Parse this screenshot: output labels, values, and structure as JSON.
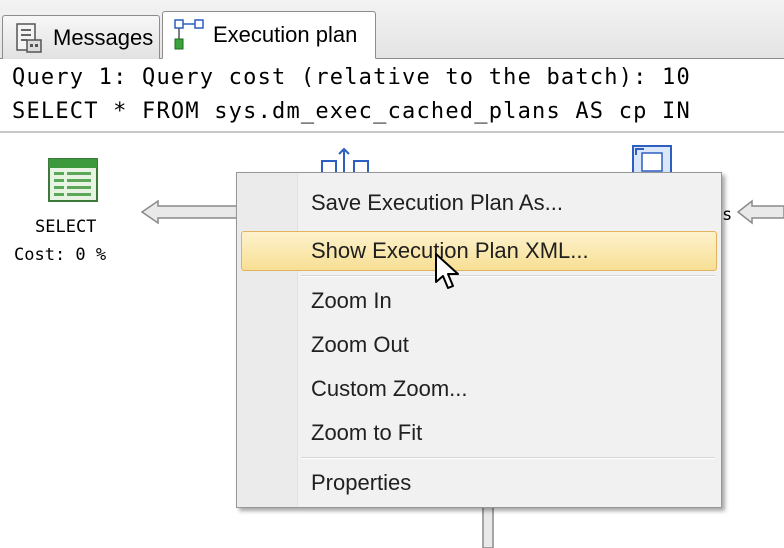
{
  "tabs": [
    {
      "label": "Messages",
      "icon": "messages-icon",
      "active": false
    },
    {
      "label": "Execution plan",
      "icon": "execution-plan-icon",
      "active": true
    }
  ],
  "query": {
    "line1": "Query 1: Query cost (relative to the batch): 10",
    "line2": "SELECT * FROM sys.dm_exec_cached_plans AS cp IN"
  },
  "plan": {
    "select_node": {
      "name": "SELECT",
      "cost": "Cost: 0 %"
    },
    "partial_right_label": "s"
  },
  "context_menu": {
    "items": [
      {
        "label": "Save Execution Plan As...",
        "hover": false
      },
      {
        "label": "Show Execution Plan XML...",
        "hover": true
      },
      {
        "label": "Zoom In",
        "hover": false
      },
      {
        "label": "Zoom Out",
        "hover": false
      },
      {
        "label": "Custom Zoom...",
        "hover": false
      },
      {
        "label": "Zoom to Fit",
        "hover": false
      },
      {
        "label": "Properties",
        "hover": false
      }
    ]
  },
  "colors": {
    "menu_background": "#f1f1f1",
    "menu_highlight": "#f7df93",
    "menu_highlight_border": "#e2b35e",
    "select_icon_green": "#3c9a3c",
    "arrow_gray": "#a8a8a8"
  }
}
